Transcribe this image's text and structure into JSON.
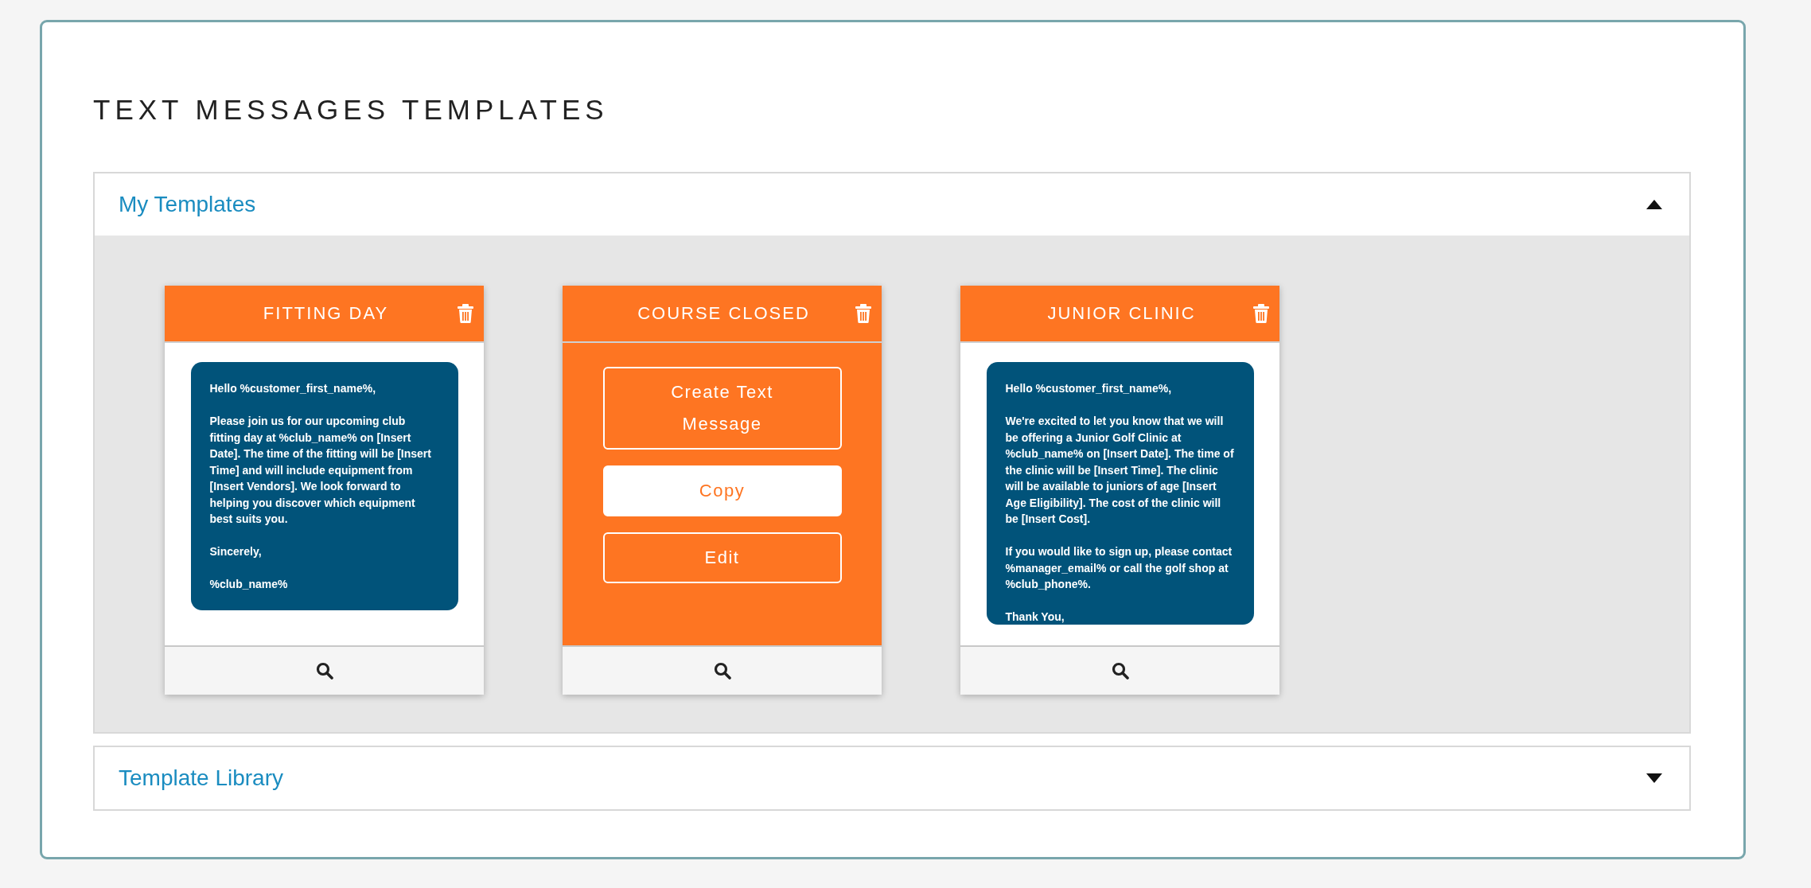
{
  "title": "TEXT MESSAGES TEMPLATES",
  "sections": [
    {
      "label": "My Templates",
      "expanded": true,
      "cards": [
        {
          "title": "FITTING DAY",
          "hovered": false,
          "message": "Hello %customer_first_name%,\n\nPlease join us for our upcoming club fitting day at %club_name% on [Insert Date]. The time of the fitting will be [Insert Time] and will include equipment from [Insert Vendors]. We look forward to helping you discover which equipment best suits you.\n\nSincerely,\n\n%club_name%"
        },
        {
          "title": "COURSE CLOSED",
          "hovered": true,
          "actions": [
            {
              "label": "Create Text Message",
              "highlighted": false
            },
            {
              "label": "Copy",
              "highlighted": true
            },
            {
              "label": "Edit",
              "highlighted": false
            }
          ]
        },
        {
          "title": "JUNIOR CLINIC",
          "hovered": false,
          "message": "Hello %customer_first_name%,\n\nWe're excited to let you know that we will be offering a Junior Golf Clinic at %club_name% on [Insert Date]. The time of the clinic will be [Insert Time]. The clinic will be available to juniors of age [Insert Age Eligibility]. The cost of the clinic will be [Insert Cost].\n\nIf you would like to sign up, please contact %manager_email% or call the golf shop at %club_phone%.\n\nThank You,"
        }
      ]
    },
    {
      "label": "Template Library",
      "expanded": false
    }
  ]
}
